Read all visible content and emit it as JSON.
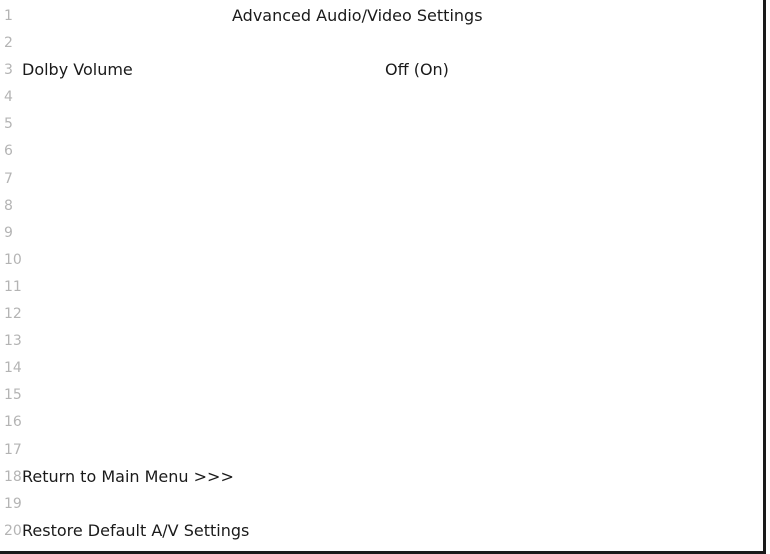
{
  "title": "Advanced Audio/Video Settings",
  "line_numbers": [
    "1",
    "2",
    "3",
    "4",
    "5",
    "6",
    "7",
    "8",
    "9",
    "10",
    "11",
    "12",
    "13",
    "14",
    "15",
    "16",
    "17",
    "18",
    "19",
    "20"
  ],
  "settings": {
    "dolby_volume": {
      "label": "Dolby Volume",
      "value": "Off (On)"
    }
  },
  "menu": {
    "return_main": "Return to Main Menu >>>",
    "restore_defaults": "Restore Default A/V Settings"
  },
  "colors": {
    "line_number": "#b4b4b4",
    "text": "#1a1a1a",
    "border": "#1a1a1a",
    "background": "#ffffff"
  }
}
